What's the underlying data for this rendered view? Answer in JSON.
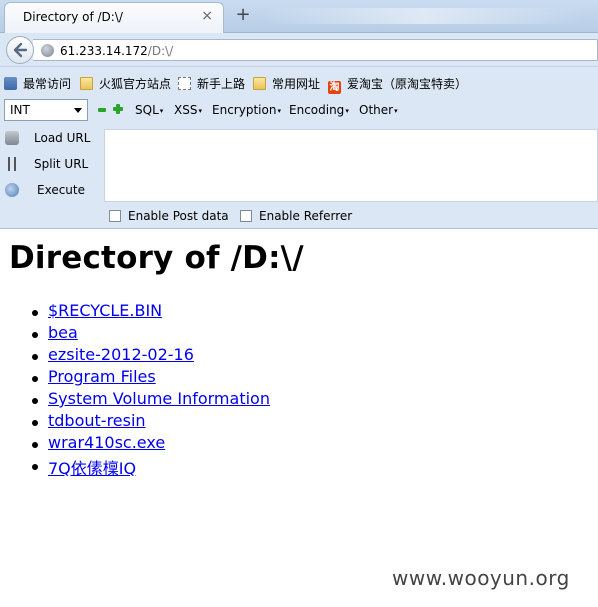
{
  "browser": {
    "tab": {
      "title": "Directory of /D:\\/",
      "close": "×"
    },
    "new_tab": "+",
    "url": {
      "host": "61.233.14.172",
      "path": "/D:\\/"
    }
  },
  "bookmarks": [
    {
      "label": "最常访问",
      "icon": "star-icon"
    },
    {
      "label": "火狐官方站点",
      "icon": "folder-icon"
    },
    {
      "label": "新手上路",
      "icon": "page-icon"
    },
    {
      "label": "常用网址",
      "icon": "folder-icon"
    },
    {
      "label": "爱淘宝（原淘宝特卖）",
      "icon": "taobao-icon",
      "icon_text": "淘"
    }
  ],
  "hackbar": {
    "select_value": "INT",
    "menus": [
      "SQL",
      "XSS",
      "Encryption",
      "Encoding",
      "Other"
    ],
    "caret": "▾",
    "side_buttons": [
      {
        "label": "Load URL",
        "icon": "load-url-icon"
      },
      {
        "label": "Split URL",
        "icon": "split-url-icon"
      },
      {
        "label": "Execute",
        "icon": "execute-icon"
      }
    ],
    "checkboxes": [
      {
        "label": "Enable Post data",
        "checked": false
      },
      {
        "label": "Enable Referrer",
        "checked": false
      }
    ]
  },
  "page": {
    "title": "Directory of /D:\\/",
    "entries": [
      "$RECYCLE.BIN",
      "bea",
      "ezsite-2012-02-16",
      "Program Files",
      "System Volume Information",
      "tdbout-resin",
      "wrar410sc.exe",
      "7Q依傃檁IQ"
    ]
  },
  "watermark": "www.wooyun.org"
}
